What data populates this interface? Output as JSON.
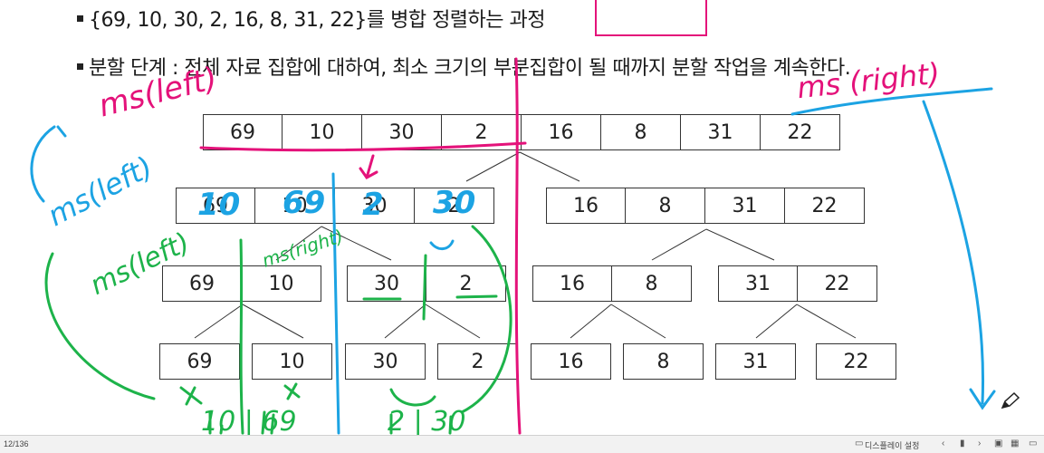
{
  "slide": {
    "bullets": [
      "{69, 10, 30, 2, 16, 8, 31, 22}를 병합 정렬하는 과정",
      "분할 단계 : 전체 자료 집합에 대하여, 최소 크기의 부분집합이 될 때까지 분할 작업을 계속한다."
    ],
    "level0": [
      "69",
      "10",
      "30",
      "2",
      "16",
      "8",
      "31",
      "22"
    ],
    "level1_left": [
      "69",
      "10",
      "30",
      "2"
    ],
    "level1_right": [
      "16",
      "8",
      "31",
      "22"
    ],
    "level2": [
      [
        "69",
        "10"
      ],
      [
        "30",
        "2"
      ],
      [
        "16",
        "8"
      ],
      [
        "31",
        "22"
      ]
    ],
    "level3": [
      "69",
      "10",
      "30",
      "2",
      "16",
      "8",
      "31",
      "22"
    ]
  },
  "annotations": {
    "colors": {
      "pink": "#e4127a",
      "blue": "#1ca3e3",
      "green": "#1db34a"
    },
    "ms_left_top": "ms(left)",
    "ms_right_top": "ms (right)",
    "ms_left_side": "ms(left)",
    "ms_left_mid": "ms(left)",
    "ms_right_mid": "ms(right)",
    "over_69": "10",
    "over_10": "69",
    "over_30": "2",
    "over_2": "30",
    "bottom_left": "10 | 69",
    "bottom_right": "2 | 30"
  },
  "statusbar": {
    "page": "12/136",
    "display_settings": "디스플레이 설정"
  }
}
